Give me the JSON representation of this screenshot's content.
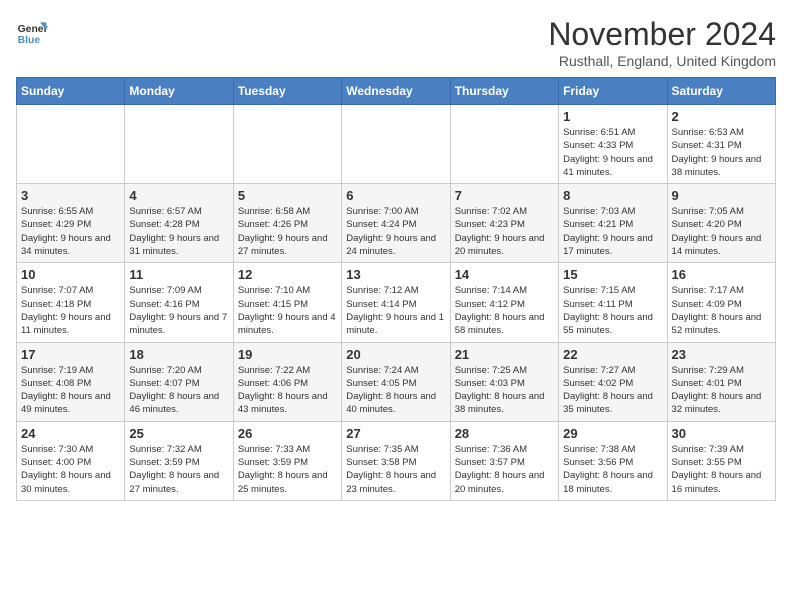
{
  "logo": {
    "line1": "General",
    "line2": "Blue"
  },
  "title": "November 2024",
  "location": "Rusthall, England, United Kingdom",
  "days_of_week": [
    "Sunday",
    "Monday",
    "Tuesday",
    "Wednesday",
    "Thursday",
    "Friday",
    "Saturday"
  ],
  "weeks": [
    [
      {
        "day": "",
        "info": ""
      },
      {
        "day": "",
        "info": ""
      },
      {
        "day": "",
        "info": ""
      },
      {
        "day": "",
        "info": ""
      },
      {
        "day": "",
        "info": ""
      },
      {
        "day": "1",
        "info": "Sunrise: 6:51 AM\nSunset: 4:33 PM\nDaylight: 9 hours and 41 minutes."
      },
      {
        "day": "2",
        "info": "Sunrise: 6:53 AM\nSunset: 4:31 PM\nDaylight: 9 hours and 38 minutes."
      }
    ],
    [
      {
        "day": "3",
        "info": "Sunrise: 6:55 AM\nSunset: 4:29 PM\nDaylight: 9 hours and 34 minutes."
      },
      {
        "day": "4",
        "info": "Sunrise: 6:57 AM\nSunset: 4:28 PM\nDaylight: 9 hours and 31 minutes."
      },
      {
        "day": "5",
        "info": "Sunrise: 6:58 AM\nSunset: 4:26 PM\nDaylight: 9 hours and 27 minutes."
      },
      {
        "day": "6",
        "info": "Sunrise: 7:00 AM\nSunset: 4:24 PM\nDaylight: 9 hours and 24 minutes."
      },
      {
        "day": "7",
        "info": "Sunrise: 7:02 AM\nSunset: 4:23 PM\nDaylight: 9 hours and 20 minutes."
      },
      {
        "day": "8",
        "info": "Sunrise: 7:03 AM\nSunset: 4:21 PM\nDaylight: 9 hours and 17 minutes."
      },
      {
        "day": "9",
        "info": "Sunrise: 7:05 AM\nSunset: 4:20 PM\nDaylight: 9 hours and 14 minutes."
      }
    ],
    [
      {
        "day": "10",
        "info": "Sunrise: 7:07 AM\nSunset: 4:18 PM\nDaylight: 9 hours and 11 minutes."
      },
      {
        "day": "11",
        "info": "Sunrise: 7:09 AM\nSunset: 4:16 PM\nDaylight: 9 hours and 7 minutes."
      },
      {
        "day": "12",
        "info": "Sunrise: 7:10 AM\nSunset: 4:15 PM\nDaylight: 9 hours and 4 minutes."
      },
      {
        "day": "13",
        "info": "Sunrise: 7:12 AM\nSunset: 4:14 PM\nDaylight: 9 hours and 1 minute."
      },
      {
        "day": "14",
        "info": "Sunrise: 7:14 AM\nSunset: 4:12 PM\nDaylight: 8 hours and 58 minutes."
      },
      {
        "day": "15",
        "info": "Sunrise: 7:15 AM\nSunset: 4:11 PM\nDaylight: 8 hours and 55 minutes."
      },
      {
        "day": "16",
        "info": "Sunrise: 7:17 AM\nSunset: 4:09 PM\nDaylight: 8 hours and 52 minutes."
      }
    ],
    [
      {
        "day": "17",
        "info": "Sunrise: 7:19 AM\nSunset: 4:08 PM\nDaylight: 8 hours and 49 minutes."
      },
      {
        "day": "18",
        "info": "Sunrise: 7:20 AM\nSunset: 4:07 PM\nDaylight: 8 hours and 46 minutes."
      },
      {
        "day": "19",
        "info": "Sunrise: 7:22 AM\nSunset: 4:06 PM\nDaylight: 8 hours and 43 minutes."
      },
      {
        "day": "20",
        "info": "Sunrise: 7:24 AM\nSunset: 4:05 PM\nDaylight: 8 hours and 40 minutes."
      },
      {
        "day": "21",
        "info": "Sunrise: 7:25 AM\nSunset: 4:03 PM\nDaylight: 8 hours and 38 minutes."
      },
      {
        "day": "22",
        "info": "Sunrise: 7:27 AM\nSunset: 4:02 PM\nDaylight: 8 hours and 35 minutes."
      },
      {
        "day": "23",
        "info": "Sunrise: 7:29 AM\nSunset: 4:01 PM\nDaylight: 8 hours and 32 minutes."
      }
    ],
    [
      {
        "day": "24",
        "info": "Sunrise: 7:30 AM\nSunset: 4:00 PM\nDaylight: 8 hours and 30 minutes."
      },
      {
        "day": "25",
        "info": "Sunrise: 7:32 AM\nSunset: 3:59 PM\nDaylight: 8 hours and 27 minutes."
      },
      {
        "day": "26",
        "info": "Sunrise: 7:33 AM\nSunset: 3:59 PM\nDaylight: 8 hours and 25 minutes."
      },
      {
        "day": "27",
        "info": "Sunrise: 7:35 AM\nSunset: 3:58 PM\nDaylight: 8 hours and 23 minutes."
      },
      {
        "day": "28",
        "info": "Sunrise: 7:36 AM\nSunset: 3:57 PM\nDaylight: 8 hours and 20 minutes."
      },
      {
        "day": "29",
        "info": "Sunrise: 7:38 AM\nSunset: 3:56 PM\nDaylight: 8 hours and 18 minutes."
      },
      {
        "day": "30",
        "info": "Sunrise: 7:39 AM\nSunset: 3:55 PM\nDaylight: 8 hours and 16 minutes."
      }
    ]
  ]
}
